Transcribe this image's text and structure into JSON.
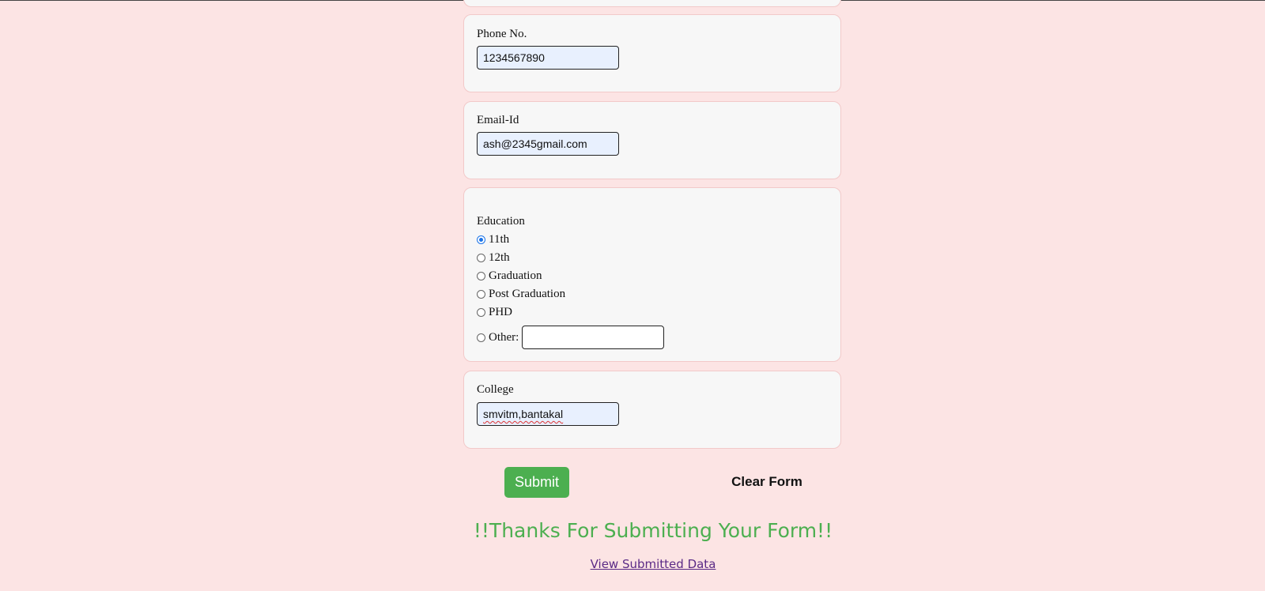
{
  "fields": {
    "phone": {
      "label": "Phone No.",
      "value": "1234567890"
    },
    "email": {
      "label": "Email-Id",
      "value": "ash@2345gmail.com"
    },
    "education": {
      "label": "Education",
      "options": [
        "11th",
        "12th",
        "Graduation",
        "Post Graduation",
        "PHD"
      ],
      "selected": "11th",
      "other_label": "Other:",
      "other_value": ""
    },
    "college": {
      "label": "College",
      "value": "smvitm,bantakal"
    }
  },
  "actions": {
    "submit_label": "Submit",
    "clear_label": "Clear Form"
  },
  "result": {
    "thanks_message": "!!Thanks For Submitting Your Form!!",
    "view_link": "View Submitted Data"
  },
  "colors": {
    "background": "#fce4e4",
    "card": "#f7f7f7",
    "submit": "#4caf50",
    "thanks": "#4caf50",
    "link": "#5b2a86",
    "radio_checked": "#1a73e8"
  }
}
